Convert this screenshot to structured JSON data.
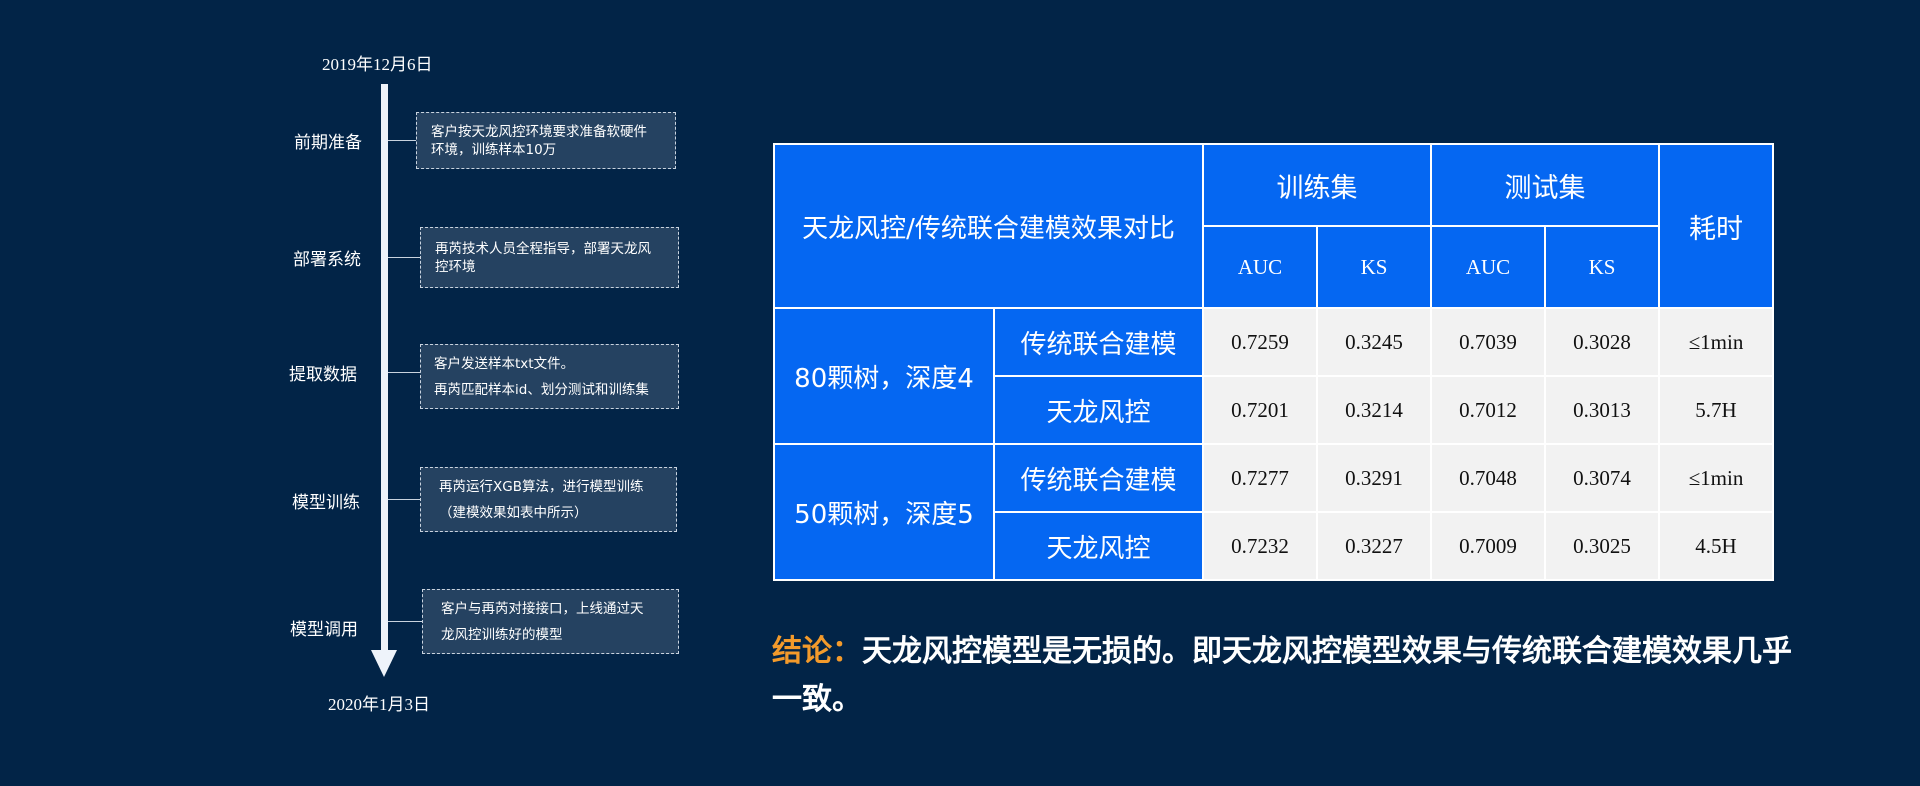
{
  "timeline": {
    "start_date": "2019年12月6日",
    "end_date": "2020年1月3日",
    "steps": [
      {
        "label": "前期准备",
        "lines": [
          "客户按天龙风控环境要求准备软硬件",
          "环境，训练样本10万"
        ]
      },
      {
        "label": "部署系统",
        "lines": [
          "再芮技术人员全程指导，部署天龙风",
          "控环境"
        ]
      },
      {
        "label": "提取数据",
        "lines": [
          "客户发送样本txt文件。",
          "再芮匹配样本id、划分测试和训练集"
        ]
      },
      {
        "label": "模型训练",
        "lines": [
          "再芮运行XGB算法，进行模型训练",
          "（建模效果如表中所示）"
        ]
      },
      {
        "label": "模型调用",
        "lines": [
          "客户与再芮对接接口，上线通过天",
          "龙风控训练好的模型"
        ]
      }
    ]
  },
  "table": {
    "title": "天龙风控/传统联合建模效果对比",
    "train_label": "训练集",
    "test_label": "测试集",
    "time_label": "耗时",
    "metrics": [
      "AUC",
      "KS",
      "AUC",
      "KS"
    ],
    "groups": [
      {
        "name": "80颗树，深度4",
        "rows": [
          {
            "method": "传统联合建模",
            "values": [
              "0.7259",
              "0.3245",
              "0.7039",
              "0.3028",
              "≤1min"
            ]
          },
          {
            "method": "天龙风控",
            "values": [
              "0.7201",
              "0.3214",
              "0.7012",
              "0.3013",
              "5.7H"
            ]
          }
        ]
      },
      {
        "name": "50颗树，深度5",
        "rows": [
          {
            "method": "传统联合建模",
            "values": [
              "0.7277",
              "0.3291",
              "0.7048",
              "0.3074",
              "≤1min"
            ]
          },
          {
            "method": "天龙风控",
            "values": [
              "0.7232",
              "0.3227",
              "0.7009",
              "0.3025",
              "4.5H"
            ]
          }
        ]
      }
    ]
  },
  "conclusion": {
    "label": "结论：",
    "text": "天龙风控模型是无损的。即天龙风控模型效果与传统联合建模效果几乎一致。"
  },
  "colors": {
    "background": "#022447",
    "table_blue": "#0567f2",
    "cell_gray": "#f2f2f2",
    "accent_orange": "#f39a2b"
  }
}
